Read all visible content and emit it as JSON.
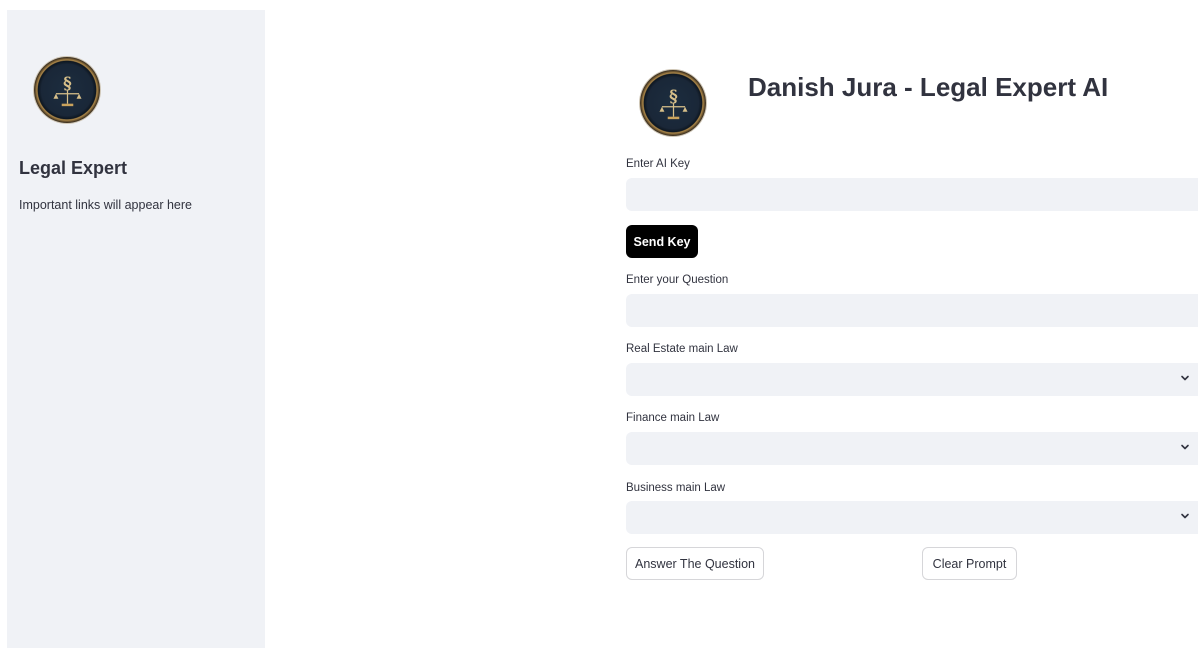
{
  "sidebar": {
    "logo_icon": "legal-seal-icon",
    "title": "Legal Expert",
    "text": "Important links will appear here"
  },
  "header": {
    "logo_icon": "legal-seal-icon",
    "title": "Danish Jura - Legal Expert AI"
  },
  "form": {
    "ai_key": {
      "label": "Enter AI Key",
      "value": "",
      "placeholder": ""
    },
    "send_key_label": "Send Key",
    "question": {
      "label": "Enter your Question",
      "value": "",
      "placeholder": ""
    },
    "real_estate": {
      "label": "Real Estate main Law",
      "selected": ""
    },
    "finance": {
      "label": "Finance main Law",
      "selected": ""
    },
    "business": {
      "label": "Business main Law",
      "selected": ""
    },
    "answer_label": "Answer The Question",
    "clear_label": "Clear Prompt"
  },
  "colors": {
    "sidebar_bg": "#f0f2f6",
    "input_bg": "#f0f2f6",
    "primary_button_bg": "#000000",
    "text": "#31333f"
  }
}
